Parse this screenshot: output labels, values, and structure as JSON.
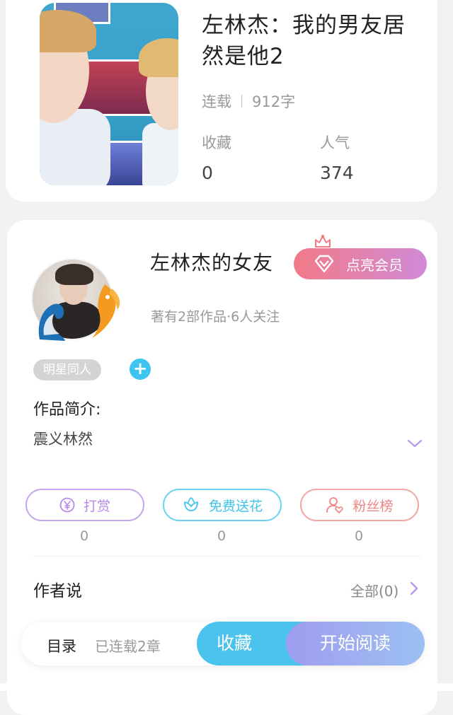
{
  "book": {
    "title": "左林杰：我的男友居然是他2",
    "status": "连载",
    "word_count": "912字",
    "stats": [
      {
        "label": "收藏",
        "value": "0"
      },
      {
        "label": "人气",
        "value": "374"
      }
    ]
  },
  "author": {
    "name": "左林杰的女友",
    "vip_label": "点亮会员",
    "subtitle": "著有2部作品·6人关注",
    "tag": "明星同人",
    "intro_label": "作品简介:",
    "intro_text": "震义林然"
  },
  "actions": [
    {
      "label": "打赏",
      "count": "0",
      "icon": "yen-icon"
    },
    {
      "label": "免费送花",
      "count": "0",
      "icon": "flower-icon"
    },
    {
      "label": "粉丝榜",
      "count": "0",
      "icon": "fan-ranking-icon"
    }
  ],
  "author_says": {
    "label": "作者说",
    "all_label": "全部(0)"
  },
  "bottom_bar": {
    "toc_label": "目录",
    "chapters_label": "已连载2章",
    "favorite_label": "收藏",
    "read_label": "开始阅读"
  },
  "colors": {
    "accent_blue": "#4cc3ec",
    "vip_gradient_start": "#f27a86",
    "vip_gradient_end": "#d18ad8",
    "read_gradient_start": "#9f9df0",
    "read_gradient_end": "#9cc0f2"
  }
}
